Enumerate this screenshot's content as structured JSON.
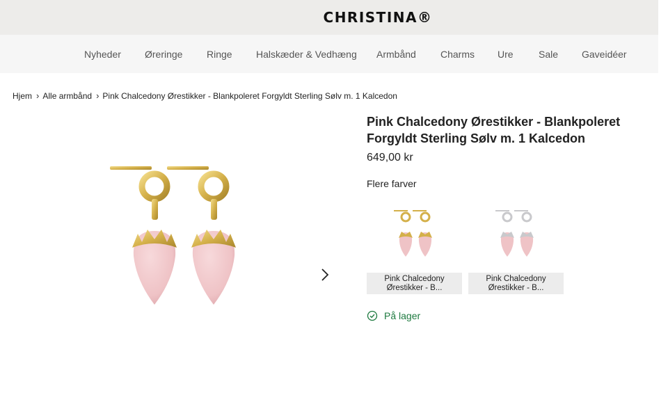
{
  "header": {
    "logo": "CHRISTINA®"
  },
  "nav": [
    "Nyheder",
    "Øreringe",
    "Ringe",
    "Halskæder & Vedhæng",
    "Armbånd",
    "Charms",
    "Ure",
    "Sale",
    "Gaveidéer"
  ],
  "breadcrumb": {
    "home": "Hjem",
    "category": "Alle armbånd",
    "current": "Pink Chalcedony Ørestikker - Blankpoleret Forgyldt Sterling Sølv m. 1 Kalcedon"
  },
  "product": {
    "title": "Pink Chalcedony Ørestikker - Blankpoleret Forgyldt Sterling Sølv m. 1 Kalcedon",
    "price": "649,00 kr",
    "colors_label": "Flere farver",
    "variants": [
      {
        "line1": "Pink Chalcedony",
        "line2": "Ørestikker - B...",
        "metal": "gold"
      },
      {
        "line1": "Pink Chalcedony",
        "line2": "Ørestikker - B...",
        "metal": "silver"
      }
    ],
    "stock": "På lager"
  },
  "colors": {
    "gold": "#d4b04a",
    "gold_dark": "#a8862c",
    "silver": "#c9c9cc",
    "stone": "#efc3c6",
    "stone_shade": "#dca4a9",
    "stock_green": "#1d7a3f"
  },
  "icons": {
    "gallery_next": "chevron-right-icon",
    "stock": "check-circle-icon"
  }
}
